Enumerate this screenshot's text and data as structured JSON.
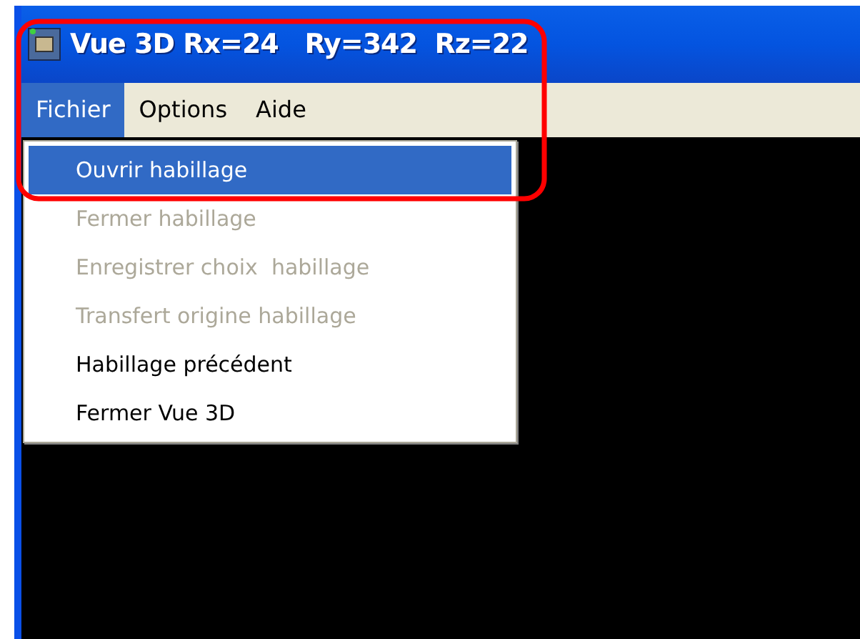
{
  "window": {
    "title": "Vue 3D Rx=24   Ry=342  Rz=22"
  },
  "menu_bar": [
    {
      "label": "Fichier",
      "selected": true
    },
    {
      "label": "Options",
      "selected": false
    },
    {
      "label": "Aide",
      "selected": false
    }
  ],
  "dropdown": [
    {
      "label": "Ouvrir habillage",
      "selected": true,
      "disabled": false
    },
    {
      "label": "Fermer habillage",
      "selected": false,
      "disabled": true
    },
    {
      "label": "Enregistrer choix  habillage",
      "selected": false,
      "disabled": true
    },
    {
      "label": "Transfert origine habillage",
      "selected": false,
      "disabled": true
    },
    {
      "label": "Habillage précédent",
      "selected": false,
      "disabled": false
    },
    {
      "label": "Fermer Vue 3D",
      "selected": false,
      "disabled": false
    }
  ]
}
